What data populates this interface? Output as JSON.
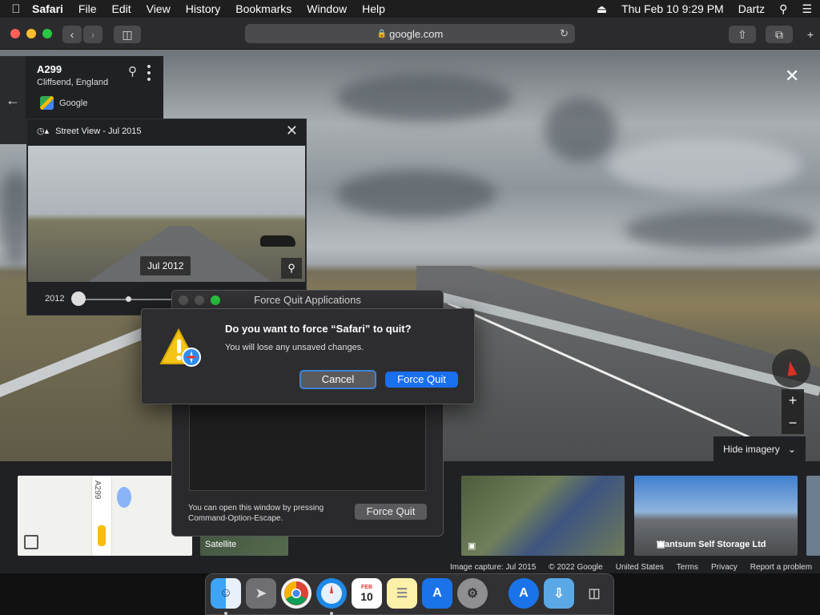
{
  "menubar": {
    "apple": "",
    "app": "Safari",
    "items": [
      "File",
      "Edit",
      "View",
      "History",
      "Bookmarks",
      "Window",
      "Help"
    ],
    "datetime": "Thu Feb 10  9:29 PM",
    "user": "Dartz",
    "icons": [
      "eject-icon",
      "search-icon",
      "list-icon"
    ]
  },
  "toolbar": {
    "address": "google.com",
    "lock_icon": "lock-icon"
  },
  "placecard": {
    "road": "A299",
    "place": "Cliffsend, England",
    "source": "Google"
  },
  "timemachine": {
    "header": "Street View - Jul 2015",
    "image_date": "Jul 2012",
    "start_year": "2012"
  },
  "controls": {
    "zoom_in": "+",
    "zoom_out": "−",
    "hide_imagery": "Hide imagery"
  },
  "strip": {
    "map_road_label": "A299",
    "satellite_label": "Satellite",
    "photo2_label": "Wantsum Self Storage Ltd"
  },
  "footer": {
    "capture": "Image capture: Jul 2015",
    "copyright": "© 2022 Google",
    "country": "United States",
    "terms": "Terms",
    "privacy": "Privacy",
    "report": "Report a problem"
  },
  "forcequit": {
    "title": "Force Quit Applications",
    "hint_line1": "You can open this window by pressing",
    "hint_line2": "Command-Option-Escape.",
    "button": "Force Quit"
  },
  "alert": {
    "question": "Do you want to force “Safari” to quit?",
    "detail": "You will lose any unsaved changes.",
    "cancel": "Cancel",
    "confirm": "Force Quit"
  },
  "dock": {
    "calendar_month": "FEB",
    "calendar_day": "10"
  },
  "colors": {
    "accent_blue": "#1a6ff0",
    "close_red": "#ff5f57",
    "minimize_yellow": "#febc2e",
    "zoom_green": "#28c840"
  }
}
